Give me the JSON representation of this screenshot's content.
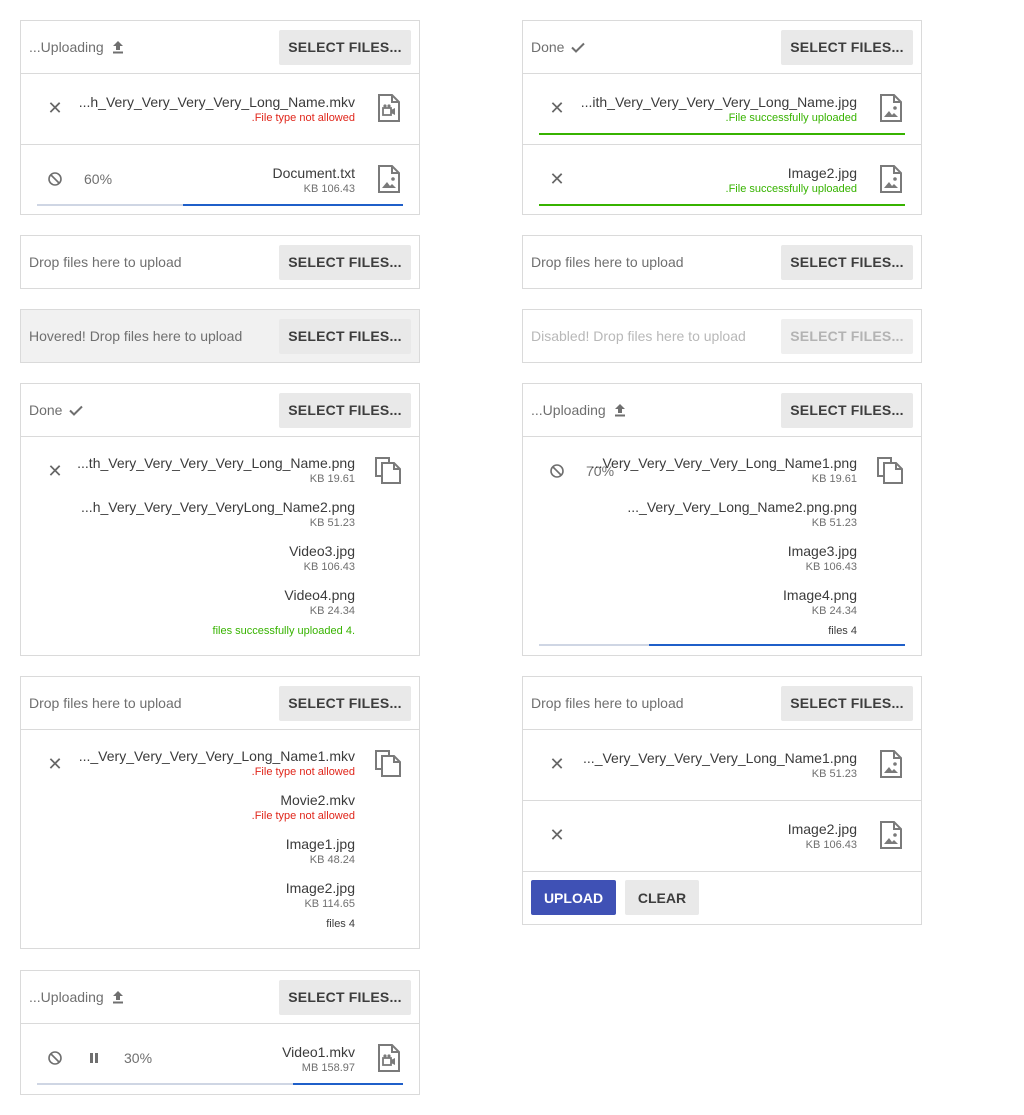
{
  "common": {
    "select_label": "SELECT FILES...",
    "drop_hint": "Drop files here to upload",
    "hovered_hint": "Hovered! Drop files here to upload",
    "disabled_hint": "Disabled! Drop files here to upload",
    "uploading": "...Uploading",
    "done": "Done",
    "upload_label": "UPLOAD",
    "clear_label": "CLEAR"
  },
  "colors": {
    "primary": "#3f51b5",
    "progress": "#1f5fc9",
    "success": "#37b300",
    "error": "#e0261b"
  },
  "p1": {
    "f1": {
      "name": "...h_Very_Very_Very_Very_Long_Name.mkv",
      "status": ".File type not allowed",
      "icon": "video-file-icon"
    },
    "f2": {
      "name": "Document.txt",
      "size": "KB 106.43",
      "progress": "60%",
      "icon": "image-file-icon"
    }
  },
  "p2": {
    "f1": {
      "name": "...ith_Very_Very_Very_Very_Long_Name.jpg",
      "status": ".File successfully uploaded",
      "icon": "image-file-icon"
    },
    "f2": {
      "name": "Image2.jpg",
      "status": ".File successfully uploaded",
      "icon": "image-file-icon"
    }
  },
  "p7": {
    "files": [
      {
        "name": "...th_Very_Very_Very_Very_Long_Name.png",
        "size": "KB 19.61"
      },
      {
        "name": "...h_Very_Very_Very_VeryLong_Name2.png",
        "size": "KB 51.23"
      },
      {
        "name": "Video3.jpg",
        "size": "KB 106.43"
      },
      {
        "name": "Video4.png",
        "size": "KB 24.34"
      }
    ],
    "summary": "files successfully uploaded 4."
  },
  "p8": {
    "files": [
      {
        "name": "...Very_Very_Very_Very_Long_Name1.png",
        "size": "KB 19.61"
      },
      {
        "name": "..._Very_Very_Long_Name2.png.png",
        "size": "KB 51.23"
      },
      {
        "name": "Image3.jpg",
        "size": "KB 106.43"
      },
      {
        "name": "Image4.png",
        "size": "KB 24.34"
      }
    ],
    "summary": "files 4",
    "progress": "70%"
  },
  "p9": {
    "files": [
      {
        "name": "..._Very_Very_Very_Very_Long_Name1.mkv",
        "status": ".File type not allowed"
      },
      {
        "name": "Movie2.mkv",
        "status": ".File type not allowed"
      },
      {
        "name": "Image1.jpg",
        "size": "KB 48.24"
      },
      {
        "name": "Image2.jpg",
        "size": "KB 114.65"
      }
    ],
    "summary": "files 4"
  },
  "p10": {
    "f1": {
      "name": "..._Very_Very_Very_Very_Long_Name1.png",
      "size": "KB 51.23"
    },
    "f2": {
      "name": "Image2.jpg",
      "size": "KB 106.43"
    }
  },
  "p11": {
    "f1": {
      "name": "Video1.mkv",
      "size": "MB 158.97",
      "progress": "30%"
    }
  }
}
